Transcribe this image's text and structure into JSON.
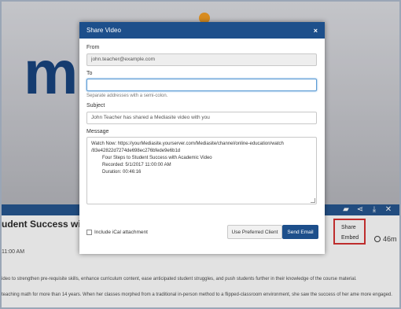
{
  "background": {
    "logo_letter": "m",
    "title": "udent Success with Ac",
    "date": "11:00 AM",
    "description_line1": "ideo to strengthen pre-requisite skills, enhance curriculum content, ease anticipated student struggles, and push students further in their knowledge of the course material.",
    "description_line2": "teaching math for more than 14 years. When her classes morphed from a traditional in-person method to a flipped-classroom environment, she saw the success of her ame more engaged.",
    "duration": "46m",
    "share_menu": {
      "items": [
        "Share",
        "Embed"
      ]
    },
    "colors": {
      "brand": "#1d4f8b",
      "accent": "#f49a1c",
      "highlight": "#d52b2b"
    }
  },
  "modal": {
    "title": "Share Video",
    "close": "×",
    "from_label": "From",
    "from_value": "john.teacher@example.com",
    "to_label": "To",
    "to_value": "",
    "to_hint": "Separate addresses with a semi-colon.",
    "subject_label": "Subject",
    "subject_value": "John Teacher has shared a Mediasite video with you",
    "message_label": "Message",
    "message": {
      "line1": "Watch Now: https://yourMediasite.yourserver.com/Mediasite/channel/online-education/watch",
      "line2": "/83e42822d7274de698ec276bfede9e6b1d",
      "line3": "Four Steps to Student Success with Academic Video",
      "line4": "Recorded: 5/1/2017 11:00:00 AM",
      "line5": "Duration: 00:46:16"
    },
    "ical_label": "Include iCal attachment",
    "preferred_client_label": "Use Preferred Client",
    "send_label": "Send Email"
  }
}
